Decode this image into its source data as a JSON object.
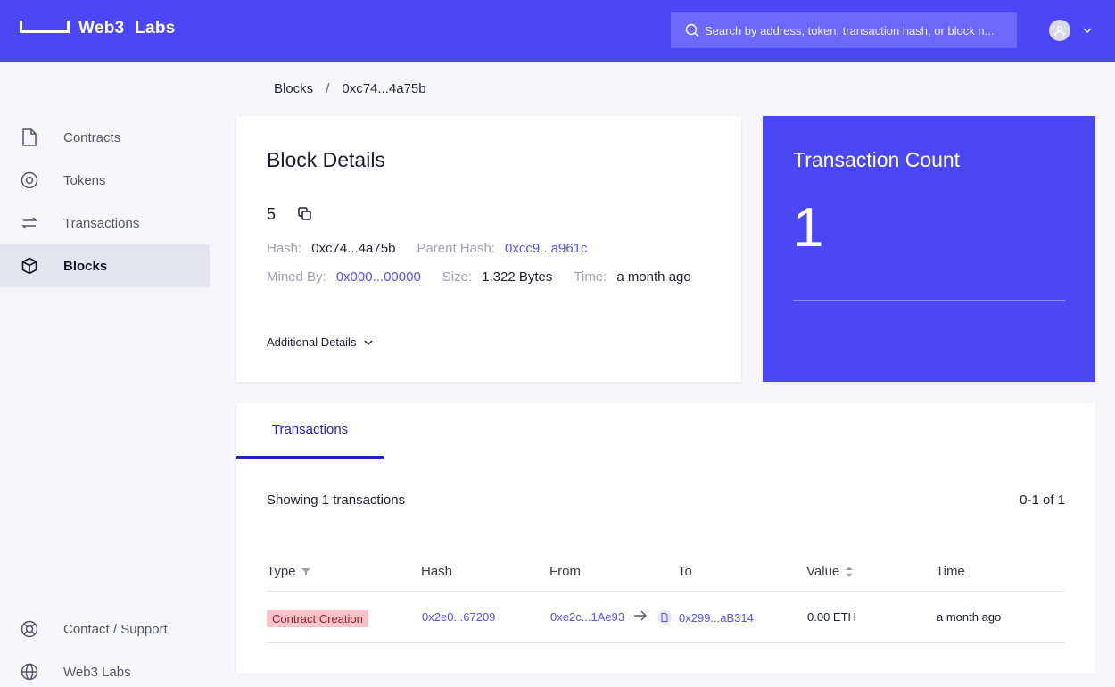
{
  "header": {
    "brand": "Web3 Labs",
    "search_placeholder": "Search by address, token, transaction hash, or block n..."
  },
  "sidebar": {
    "items": [
      {
        "label": "Contracts",
        "icon": "document-icon"
      },
      {
        "label": "Tokens",
        "icon": "token-icon"
      },
      {
        "label": "Transactions",
        "icon": "exchange-icon"
      },
      {
        "label": "Blocks",
        "icon": "cube-icon",
        "active": true
      }
    ],
    "footer": [
      {
        "label": "Contact / Support",
        "icon": "lifebuoy-icon"
      },
      {
        "label": "Web3 Labs",
        "icon": "globe-icon"
      }
    ]
  },
  "breadcrumb": {
    "root": "Blocks",
    "separator": "/",
    "current": "0xc74...4a75b"
  },
  "block": {
    "title": "Block Details",
    "number": "5",
    "hash_label": "Hash:",
    "hash": "0xc74...4a75b",
    "parent_hash_label": "Parent Hash:",
    "parent_hash": "0xcc9...a961c",
    "mined_by_label": "Mined By:",
    "mined_by": "0x000...00000",
    "size_label": "Size:",
    "size": "1,322 Bytes",
    "time_label": "Time:",
    "time": "a month ago",
    "additional_details": "Additional Details"
  },
  "tx_count": {
    "title": "Transaction Count",
    "value": "1"
  },
  "transactions": {
    "tab": "Transactions",
    "showing": "Showing 1 transactions",
    "paging": "0-1 of 1",
    "columns": [
      "Type",
      "Hash",
      "From",
      "To",
      "Value",
      "Time"
    ],
    "rows": [
      {
        "type": "Contract Creation",
        "hash": "0x2e0...67209",
        "from": "0xe2c...1Ae93",
        "to": "0x299...aB314",
        "value": "0.00 ETH",
        "time": "a month ago"
      }
    ]
  },
  "colors": {
    "brand": "#4b47f5",
    "link": "#5550f0",
    "badge_bg": "#f7c2c8"
  }
}
